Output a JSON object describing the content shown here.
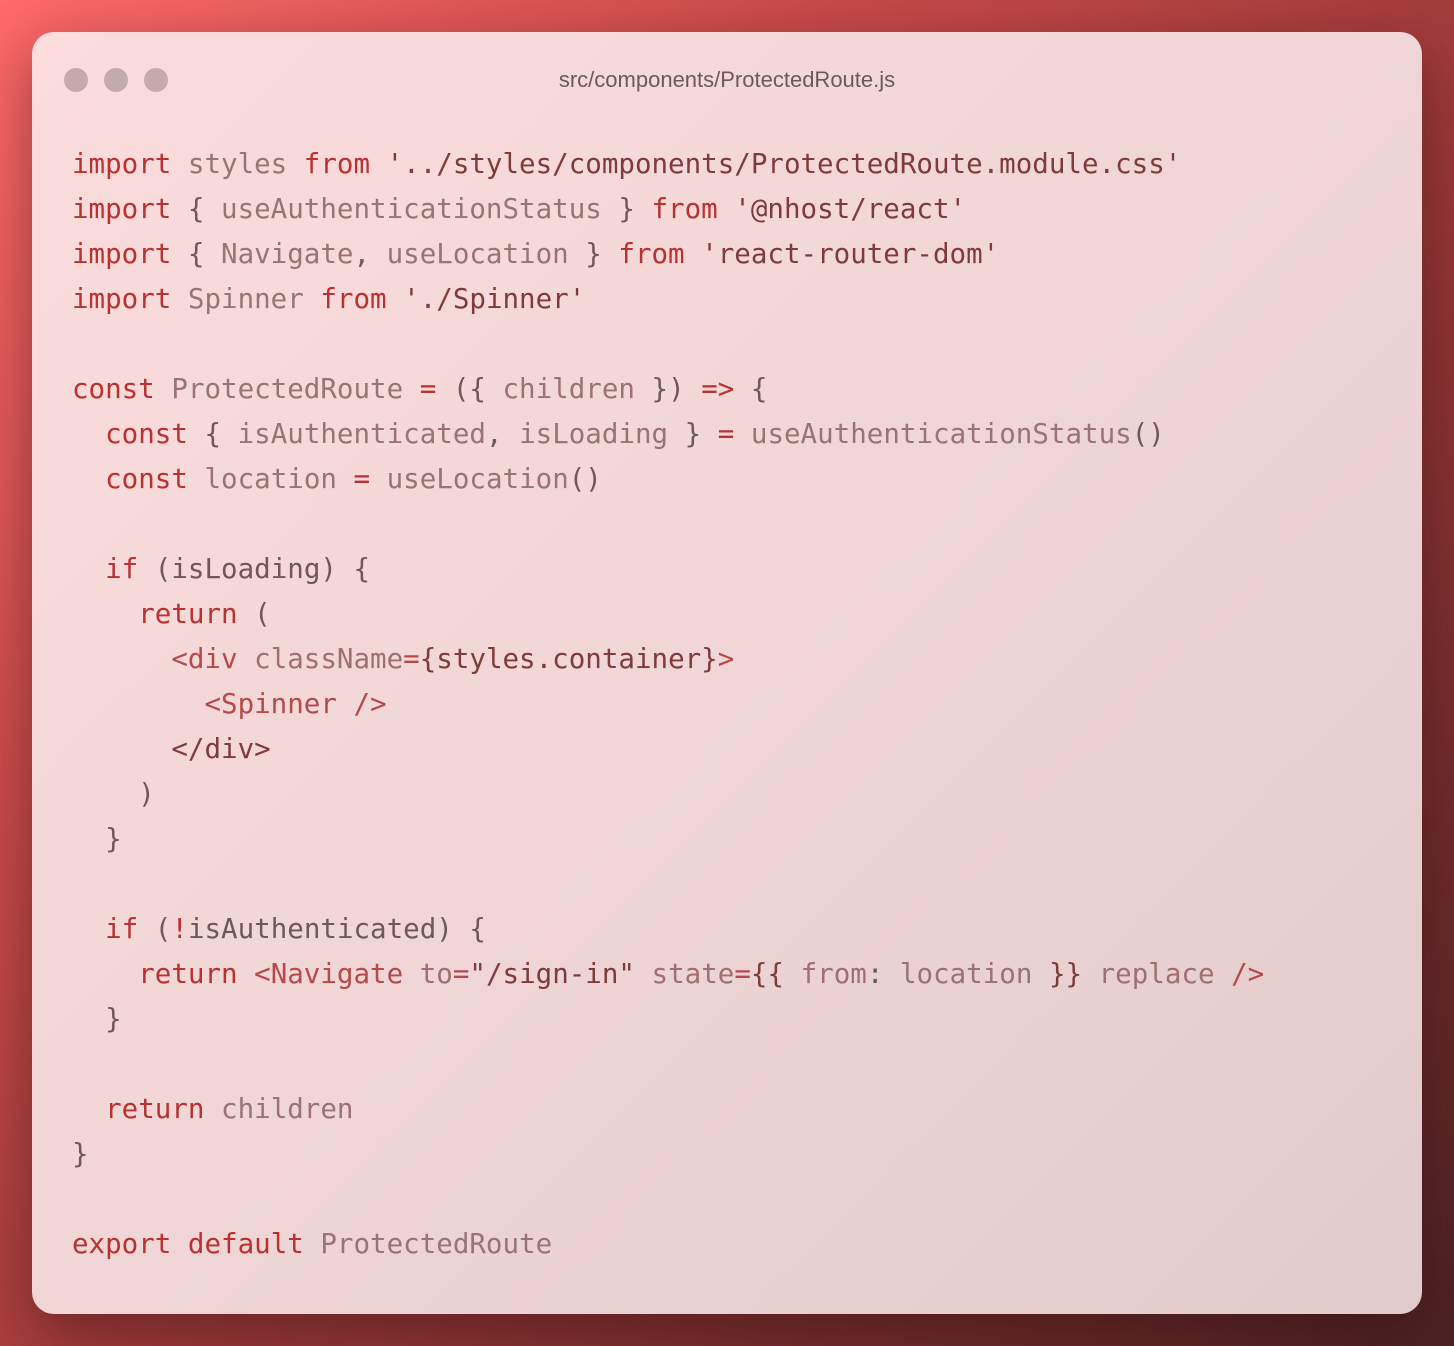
{
  "window": {
    "title": "src/components/ProtectedRoute.js",
    "buttons": [
      "close",
      "minimize",
      "maximize"
    ]
  },
  "code": {
    "lines": [
      [
        {
          "t": "import",
          "c": "kw"
        },
        {
          "t": " styles ",
          "c": "id"
        },
        {
          "t": "from",
          "c": "kw"
        },
        {
          "t": " ",
          "c": "pn"
        },
        {
          "t": "'../styles/components/ProtectedRoute.module.css'",
          "c": "str"
        }
      ],
      [
        {
          "t": "import",
          "c": "kw"
        },
        {
          "t": " { ",
          "c": "pn"
        },
        {
          "t": "useAuthenticationStatus",
          "c": "id"
        },
        {
          "t": " } ",
          "c": "pn"
        },
        {
          "t": "from",
          "c": "kw"
        },
        {
          "t": " ",
          "c": "pn"
        },
        {
          "t": "'@nhost/react'",
          "c": "str"
        }
      ],
      [
        {
          "t": "import",
          "c": "kw"
        },
        {
          "t": " { ",
          "c": "pn"
        },
        {
          "t": "Navigate",
          "c": "id"
        },
        {
          "t": ", ",
          "c": "pn"
        },
        {
          "t": "useLocation",
          "c": "id"
        },
        {
          "t": " } ",
          "c": "pn"
        },
        {
          "t": "from",
          "c": "kw"
        },
        {
          "t": " ",
          "c": "pn"
        },
        {
          "t": "'react-router-dom'",
          "c": "str"
        }
      ],
      [
        {
          "t": "import",
          "c": "kw"
        },
        {
          "t": " Spinner ",
          "c": "id"
        },
        {
          "t": "from",
          "c": "kw"
        },
        {
          "t": " ",
          "c": "pn"
        },
        {
          "t": "'./Spinner'",
          "c": "str"
        }
      ],
      [],
      [
        {
          "t": "const",
          "c": "kw"
        },
        {
          "t": " ProtectedRoute ",
          "c": "id"
        },
        {
          "t": "=",
          "c": "kw"
        },
        {
          "t": " ({ ",
          "c": "pn"
        },
        {
          "t": "children",
          "c": "id"
        },
        {
          "t": " }) ",
          "c": "pn"
        },
        {
          "t": "=>",
          "c": "kw"
        },
        {
          "t": " {",
          "c": "pn"
        }
      ],
      [
        {
          "t": "  ",
          "c": "pn"
        },
        {
          "t": "const",
          "c": "kw"
        },
        {
          "t": " { ",
          "c": "pn"
        },
        {
          "t": "isAuthenticated",
          "c": "id"
        },
        {
          "t": ", ",
          "c": "pn"
        },
        {
          "t": "isLoading",
          "c": "id"
        },
        {
          "t": " } ",
          "c": "pn"
        },
        {
          "t": "=",
          "c": "kw"
        },
        {
          "t": " ",
          "c": "pn"
        },
        {
          "t": "useAuthenticationStatus",
          "c": "id"
        },
        {
          "t": "()",
          "c": "pn"
        }
      ],
      [
        {
          "t": "  ",
          "c": "pn"
        },
        {
          "t": "const",
          "c": "kw"
        },
        {
          "t": " location ",
          "c": "id"
        },
        {
          "t": "=",
          "c": "kw"
        },
        {
          "t": " ",
          "c": "pn"
        },
        {
          "t": "useLocation",
          "c": "id"
        },
        {
          "t": "()",
          "c": "pn"
        }
      ],
      [],
      [
        {
          "t": "  ",
          "c": "pn"
        },
        {
          "t": "if",
          "c": "kw"
        },
        {
          "t": " (isLoading) {",
          "c": "pn"
        }
      ],
      [
        {
          "t": "    ",
          "c": "pn"
        },
        {
          "t": "return",
          "c": "kw"
        },
        {
          "t": " (",
          "c": "pn"
        }
      ],
      [
        {
          "t": "      ",
          "c": "pn"
        },
        {
          "t": "<div ",
          "c": "tag"
        },
        {
          "t": "className",
          "c": "attr"
        },
        {
          "t": "=",
          "c": "tag"
        },
        {
          "t": "{styles.container}",
          "c": "str"
        },
        {
          "t": ">",
          "c": "tag"
        }
      ],
      [
        {
          "t": "        ",
          "c": "pn"
        },
        {
          "t": "<Spinner ",
          "c": "tag"
        },
        {
          "t": "/>",
          "c": "tag"
        }
      ],
      [
        {
          "t": "      ",
          "c": "pn"
        },
        {
          "t": "</div>",
          "c": "str"
        }
      ],
      [
        {
          "t": "    )",
          "c": "pn"
        }
      ],
      [
        {
          "t": "  }",
          "c": "pn"
        }
      ],
      [],
      [
        {
          "t": "  ",
          "c": "pn"
        },
        {
          "t": "if",
          "c": "kw"
        },
        {
          "t": " (",
          "c": "pn"
        },
        {
          "t": "!",
          "c": "kw"
        },
        {
          "t": "isAuthenticated) {",
          "c": "pn"
        }
      ],
      [
        {
          "t": "    ",
          "c": "pn"
        },
        {
          "t": "return",
          "c": "kw"
        },
        {
          "t": " ",
          "c": "pn"
        },
        {
          "t": "<Navigate ",
          "c": "tag"
        },
        {
          "t": "to",
          "c": "attr"
        },
        {
          "t": "=",
          "c": "tag"
        },
        {
          "t": "\"/sign-in\"",
          "c": "str"
        },
        {
          "t": " ",
          "c": "pn"
        },
        {
          "t": "state",
          "c": "attr"
        },
        {
          "t": "=",
          "c": "tag"
        },
        {
          "t": "{{ ",
          "c": "str"
        },
        {
          "t": "from",
          "c": "attr"
        },
        {
          "t": ": ",
          "c": "pn"
        },
        {
          "t": "location",
          "c": "id"
        },
        {
          "t": " }}",
          "c": "str"
        },
        {
          "t": " ",
          "c": "pn"
        },
        {
          "t": "replace",
          "c": "attr"
        },
        {
          "t": " ",
          "c": "pn"
        },
        {
          "t": "/>",
          "c": "tag"
        }
      ],
      [
        {
          "t": "  }",
          "c": "pn"
        }
      ],
      [],
      [
        {
          "t": "  ",
          "c": "pn"
        },
        {
          "t": "return",
          "c": "kw"
        },
        {
          "t": " children",
          "c": "id"
        }
      ],
      [
        {
          "t": "}",
          "c": "pn"
        }
      ],
      [],
      [
        {
          "t": "export",
          "c": "kw"
        },
        {
          "t": " ",
          "c": "pn"
        },
        {
          "t": "default",
          "c": "kw"
        },
        {
          "t": " ProtectedRoute",
          "c": "id"
        }
      ]
    ]
  }
}
